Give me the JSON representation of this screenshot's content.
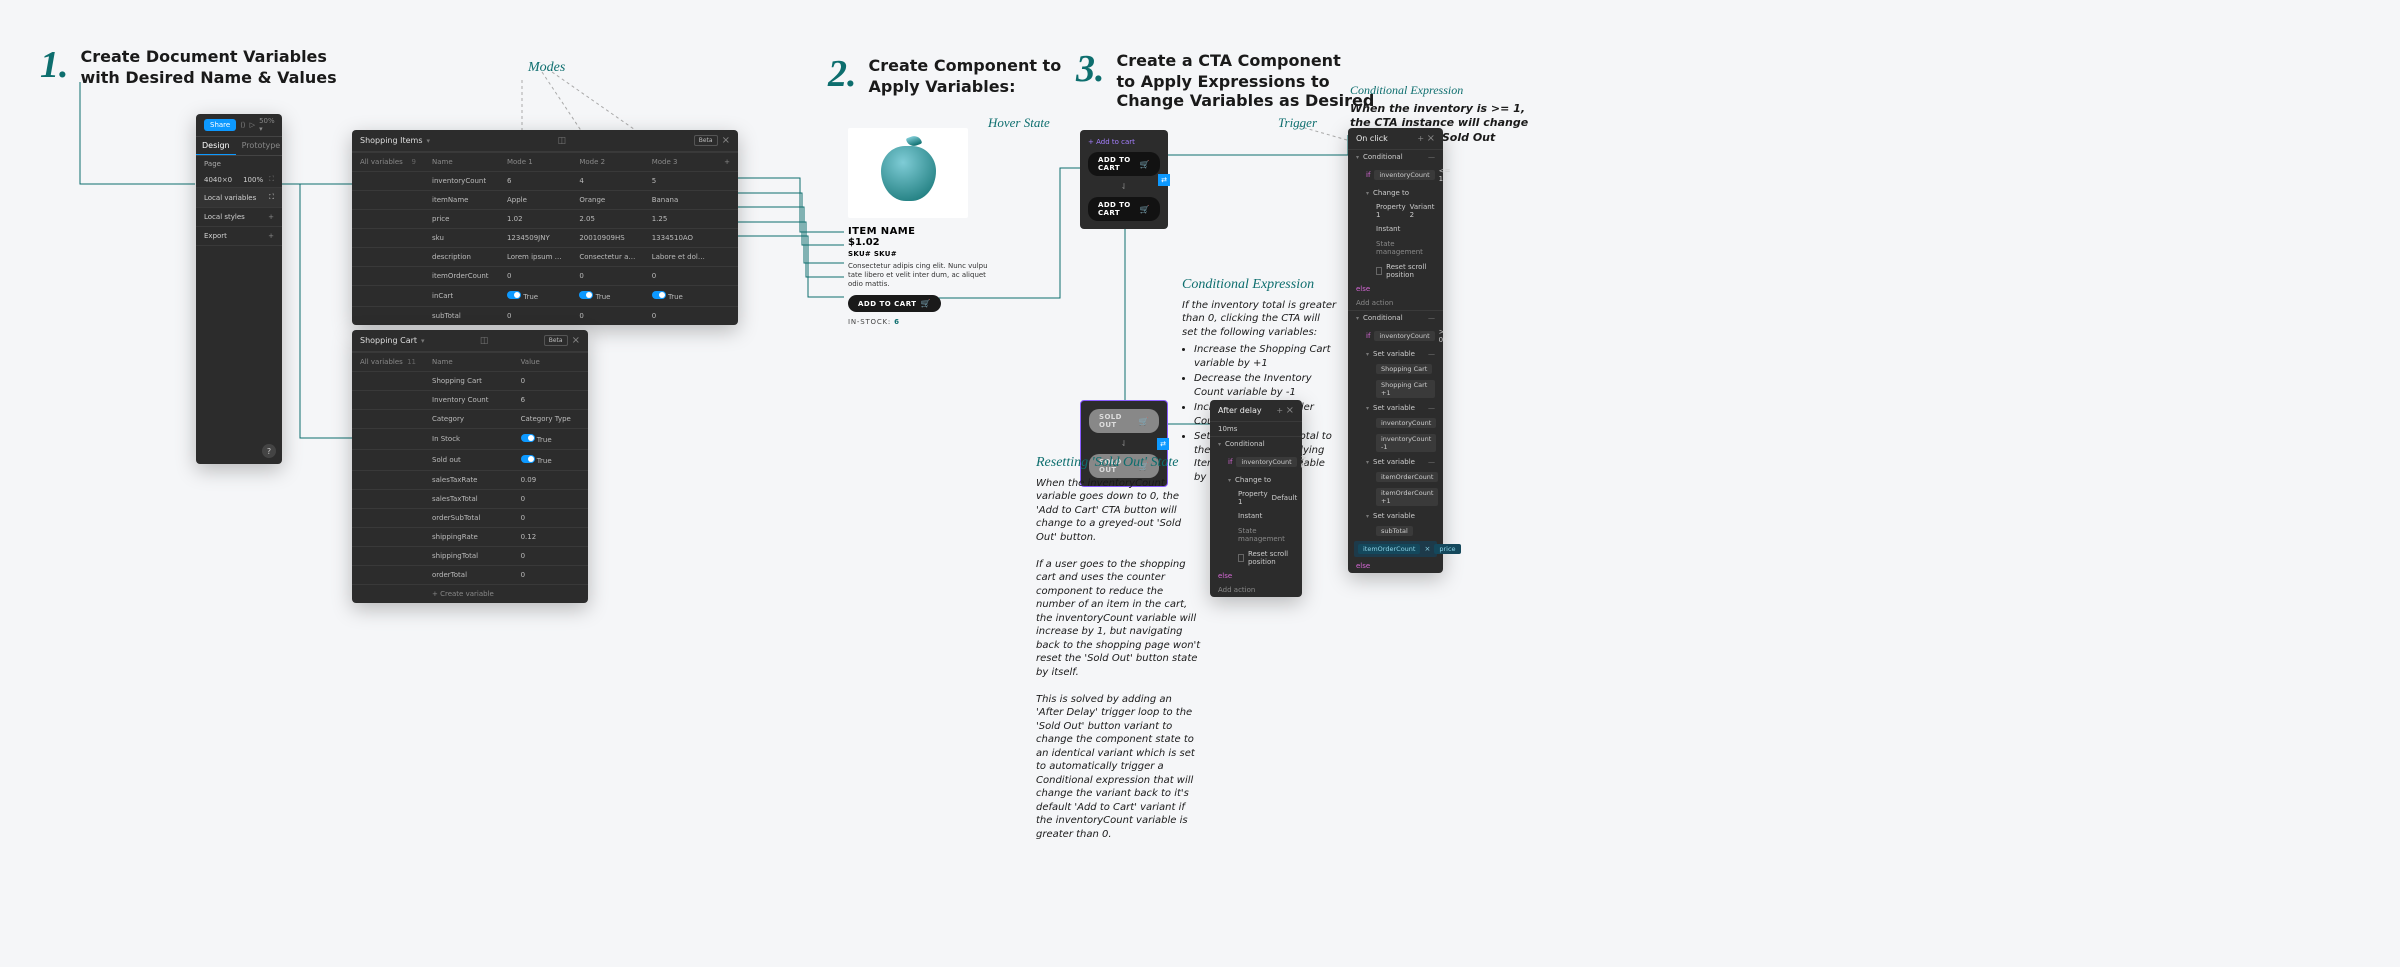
{
  "steps": {
    "s1": {
      "num": "1.",
      "line1": "Create Document Variables",
      "line2": "with Desired Name & Values"
    },
    "s2": {
      "num": "2.",
      "line1": "Create Component to",
      "line2": "Apply Variables:"
    },
    "s3": {
      "num": "3.",
      "line1": "Create a CTA Component",
      "line2": "to Apply Expressions to",
      "line3": "Change Variables as Desired"
    }
  },
  "callouts": {
    "modes": "Modes",
    "hover": "Hover State",
    "trigger": "Trigger",
    "condExprTop": "Conditional Expression",
    "condExprTopBody": "When the inventory is >= 1, the CTA instance will change to 'Variant 2' - Sold Out",
    "condExprMid": "Conditional Expression",
    "condExprMidBody": "If the inventory total is greater than 0, clicking the CTA will set the following variables:",
    "condBul1": "Increase the Shopping Cart variable by +1",
    "condBul2": "Decrease the Inventory Count variable by -1",
    "condBul3": "Increase the Item Order Count variable by +1",
    "condBul4": "Set the variable Subtotal to the product of multiplying Item Order Count variable by the Price variable",
    "resetTitle": "Resetting 'Sold Out' State",
    "resetP1": "When the inventoryCount variable goes down to 0, the 'Add to Cart' CTA button will change to a greyed-out 'Sold Out' button.",
    "resetP2": "If a user goes to the shopping cart and uses the counter component to reduce the number of an item in the cart, the inventoryCount variable will increase by 1, but navigating back to the shopping page won't reset the 'Sold Out' button state by itself.",
    "resetP3": "This is solved by adding an 'After Delay' trigger loop to the 'Sold Out' button variant to change the component state to an identical variant which is set to automatically trigger a Conditional expression that will change the variant back to it's default 'Add to Cart' variant if the inventoryCount variable is greater than 0."
  },
  "designPanel": {
    "share": "Share",
    "designTab": "Design",
    "protoTab": "Prototype",
    "page": "Page",
    "pageW": "4040×0",
    "pageZoom": "100%",
    "localVars": "Local variables",
    "localStyles": "Local styles",
    "export": "Export"
  },
  "itemsTable": {
    "title": "Shopping Items",
    "allVars": "All variables",
    "count": "9",
    "betaTag": "Beta",
    "hName": "Name",
    "hMode1": "Mode 1",
    "hMode2": "Mode 2",
    "hMode3": "Mode 3",
    "rows": {
      "inventoryCount": {
        "n": "inventoryCount",
        "m1": "6",
        "m2": "4",
        "m3": "5"
      },
      "itemName": {
        "n": "itemName",
        "m1": "Apple",
        "m2": "Orange",
        "m3": "Banana"
      },
      "price": {
        "n": "price",
        "m1": "1.02",
        "m2": "2.05",
        "m3": "1.25"
      },
      "sku": {
        "n": "sku",
        "m1": "1234509JNY",
        "m2": "20010909HS",
        "m3": "1334510AO"
      },
      "description": {
        "n": "description",
        "m1": "Lorem ipsum dolor sit amet, con",
        "m2": "Consectetur adipis cing elit. Nun",
        "m3": "Labore et dolore onsectatur adip"
      },
      "itemOrderCount": {
        "n": "itemOrderCount",
        "m1": "0",
        "m2": "0",
        "m3": "0"
      },
      "inCart": {
        "n": "inCart",
        "m1": "True",
        "m2": "True",
        "m3": "True"
      },
      "subTotal": {
        "n": "subTotal",
        "m1": "0",
        "m2": "0",
        "m3": "0"
      }
    }
  },
  "cartTable": {
    "title": "Shopping Cart",
    "allVars": "All variables",
    "count": "11",
    "betaTag": "Beta",
    "hName": "Name",
    "hValue": "Value",
    "rows": {
      "shoppingCart": {
        "n": "Shopping Cart",
        "v": "0"
      },
      "inventoryCount": {
        "n": "Inventory Count",
        "v": "6"
      },
      "category": {
        "n": "Category",
        "v": "Category Type"
      },
      "inStock": {
        "n": "In Stock",
        "v": "True"
      },
      "soldOut": {
        "n": "Sold out",
        "v": "True"
      },
      "salesTaxRate": {
        "n": "salesTaxRate",
        "v": "0.09"
      },
      "salesTaxTotal": {
        "n": "salesTaxTotal",
        "v": "0"
      },
      "orderSubTotal": {
        "n": "orderSubTotal",
        "v": "0"
      },
      "shippingRate": {
        "n": "shippingRate",
        "v": "0.12"
      },
      "shippingTotal": {
        "n": "shippingTotal",
        "v": "0"
      },
      "orderTotal": {
        "n": "orderTotal",
        "v": "0"
      },
      "create": "+  Create variable"
    }
  },
  "product": {
    "name": "ITEM NAME",
    "price": "$1.02",
    "sku": "SKU# SKU#",
    "desc": "Consectetur adipis cing elit. Nunc vulpu tate libero et velit inter dum, ac aliquet odio mattis.",
    "cta": "ADD TO CART",
    "instockLabel": "IN-STOCK:",
    "instockN": "6"
  },
  "ctaHover": {
    "addLabel": "+ Add to cart",
    "pill1": "ADD TO CART",
    "pill2": "ADD TO CART"
  },
  "ctaSoldOut": {
    "pill1": "SOLD OUT",
    "pill2": "SOLD OUT"
  },
  "onClickPanel": {
    "head": "On click",
    "conditional": "Conditional",
    "ifInv": "inventoryCount",
    "ifOp": "<= 1",
    "changeTo": "Change to",
    "prop1": "Property 1",
    "variant2": "Variant 2",
    "instant": "Instant",
    "stateMgmt": "State management",
    "resetScroll": "Reset scroll position",
    "else": "else",
    "addAction": "Add action",
    "conditional2": "Conditional",
    "ifInv2": "inventoryCount",
    "ifOp2": "> 0",
    "setVar": "Set variable",
    "shoppingCart": "Shopping Cart",
    "scPlus": "Shopping Cart  +1",
    "invCount": "inventoryCount",
    "invMinus": "inventoryCount  -1",
    "ioc": "itemOrderCount",
    "iocPlus": "itemOrderCount  +1",
    "subTotal": "subTotal",
    "iocTimesPrice": "itemOrderCount",
    "priceChip": "price",
    "mult": "×"
  },
  "afterDelayPanel": {
    "head": "After delay",
    "delay": "10ms",
    "conditional": "Conditional",
    "ifInv": "inventoryCount",
    "ifOp": "> 0",
    "changeTo": "Change to",
    "prop1": "Property 1",
    "default": "Default",
    "instant": "Instant",
    "stateMgmt": "State management",
    "resetScroll": "Reset scroll position",
    "else": "else",
    "addAction": "Add action"
  }
}
